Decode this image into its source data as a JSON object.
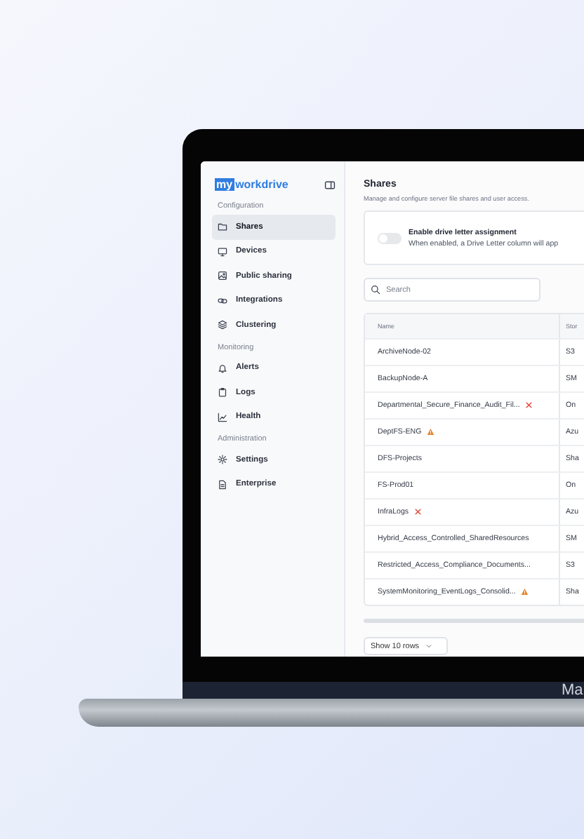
{
  "sidebar": {
    "logo": {
      "badge": "my",
      "word": "workdrive"
    },
    "groups": [
      {
        "heading": "Configuration",
        "items": [
          {
            "label": "Shares",
            "selected": true
          },
          {
            "label": "Devices",
            "selected": false
          },
          {
            "label": "Public sharing",
            "selected": false
          },
          {
            "label": "Integrations",
            "selected": false
          },
          {
            "label": "Clustering",
            "selected": false
          }
        ]
      },
      {
        "heading": "Monitoring",
        "items": [
          {
            "label": "Alerts",
            "selected": false
          },
          {
            "label": "Logs",
            "selected": false
          },
          {
            "label": "Health",
            "selected": false
          }
        ]
      },
      {
        "heading": "Administration",
        "items": [
          {
            "label": "Settings",
            "selected": false
          },
          {
            "label": "Enterprise",
            "selected": false
          }
        ]
      }
    ]
  },
  "page": {
    "title": "Shares",
    "description": "Manage and configure server file shares and user access.",
    "drive_letter": {
      "label": "Enable drive letter assignment",
      "hint": "When enabled, a Drive Letter column will app",
      "on": false
    },
    "search": {
      "placeholder": "Search"
    },
    "table": {
      "columns": [
        "Name",
        "Stor"
      ],
      "rows": [
        {
          "name": "ArchiveNode-02",
          "storage": "S3",
          "kind": "plain"
        },
        {
          "name": "BackupNode-A",
          "storage": "SM",
          "kind": "plain"
        },
        {
          "name": "Departmental_Secure_Finance_Audit_Fil...",
          "storage": "On",
          "kind": "error"
        },
        {
          "name": "DeptFS-ENG",
          "storage": "Azu",
          "kind": "warning"
        },
        {
          "name": "DFS-Projects",
          "storage": "Sha",
          "kind": "plain"
        },
        {
          "name": "FS-Prod01",
          "storage": "On",
          "kind": "plain"
        },
        {
          "name": "InfraLogs",
          "storage": "Azu",
          "kind": "error"
        },
        {
          "name": "Hybrid_Access_Controlled_SharedResources",
          "storage": "SM",
          "kind": "plain"
        },
        {
          "name": "Restricted_Access_Compliance_Documents...",
          "storage": "S3",
          "kind": "plain"
        },
        {
          "name": "SystemMonitoring_EventLogs_Consolid...",
          "storage": "Sha",
          "kind": "warning"
        }
      ]
    },
    "page_size": "Show 10 rows"
  },
  "laptop_label": "Ma"
}
